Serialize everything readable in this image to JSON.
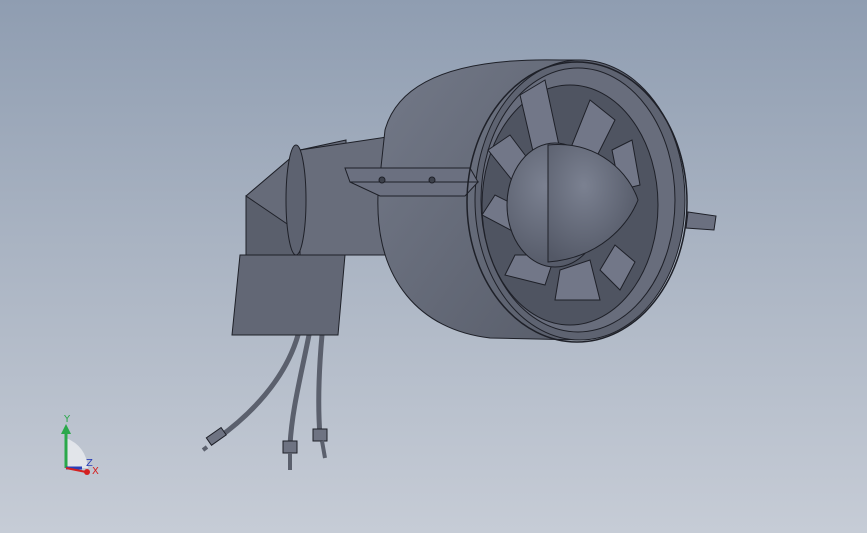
{
  "viewport": {
    "background_top": "#8f9db1",
    "background_bottom": "#c6ccd6",
    "part_color": "#6a6f7e",
    "part_shadow": "#4a4e5a",
    "edge_color": "#1e2028"
  },
  "triad": {
    "x_label": "X",
    "y_label": "Y",
    "z_label": "Z",
    "x_color": "#d42020",
    "y_color": "#2aa84a",
    "z_color": "#2b3fb8"
  }
}
